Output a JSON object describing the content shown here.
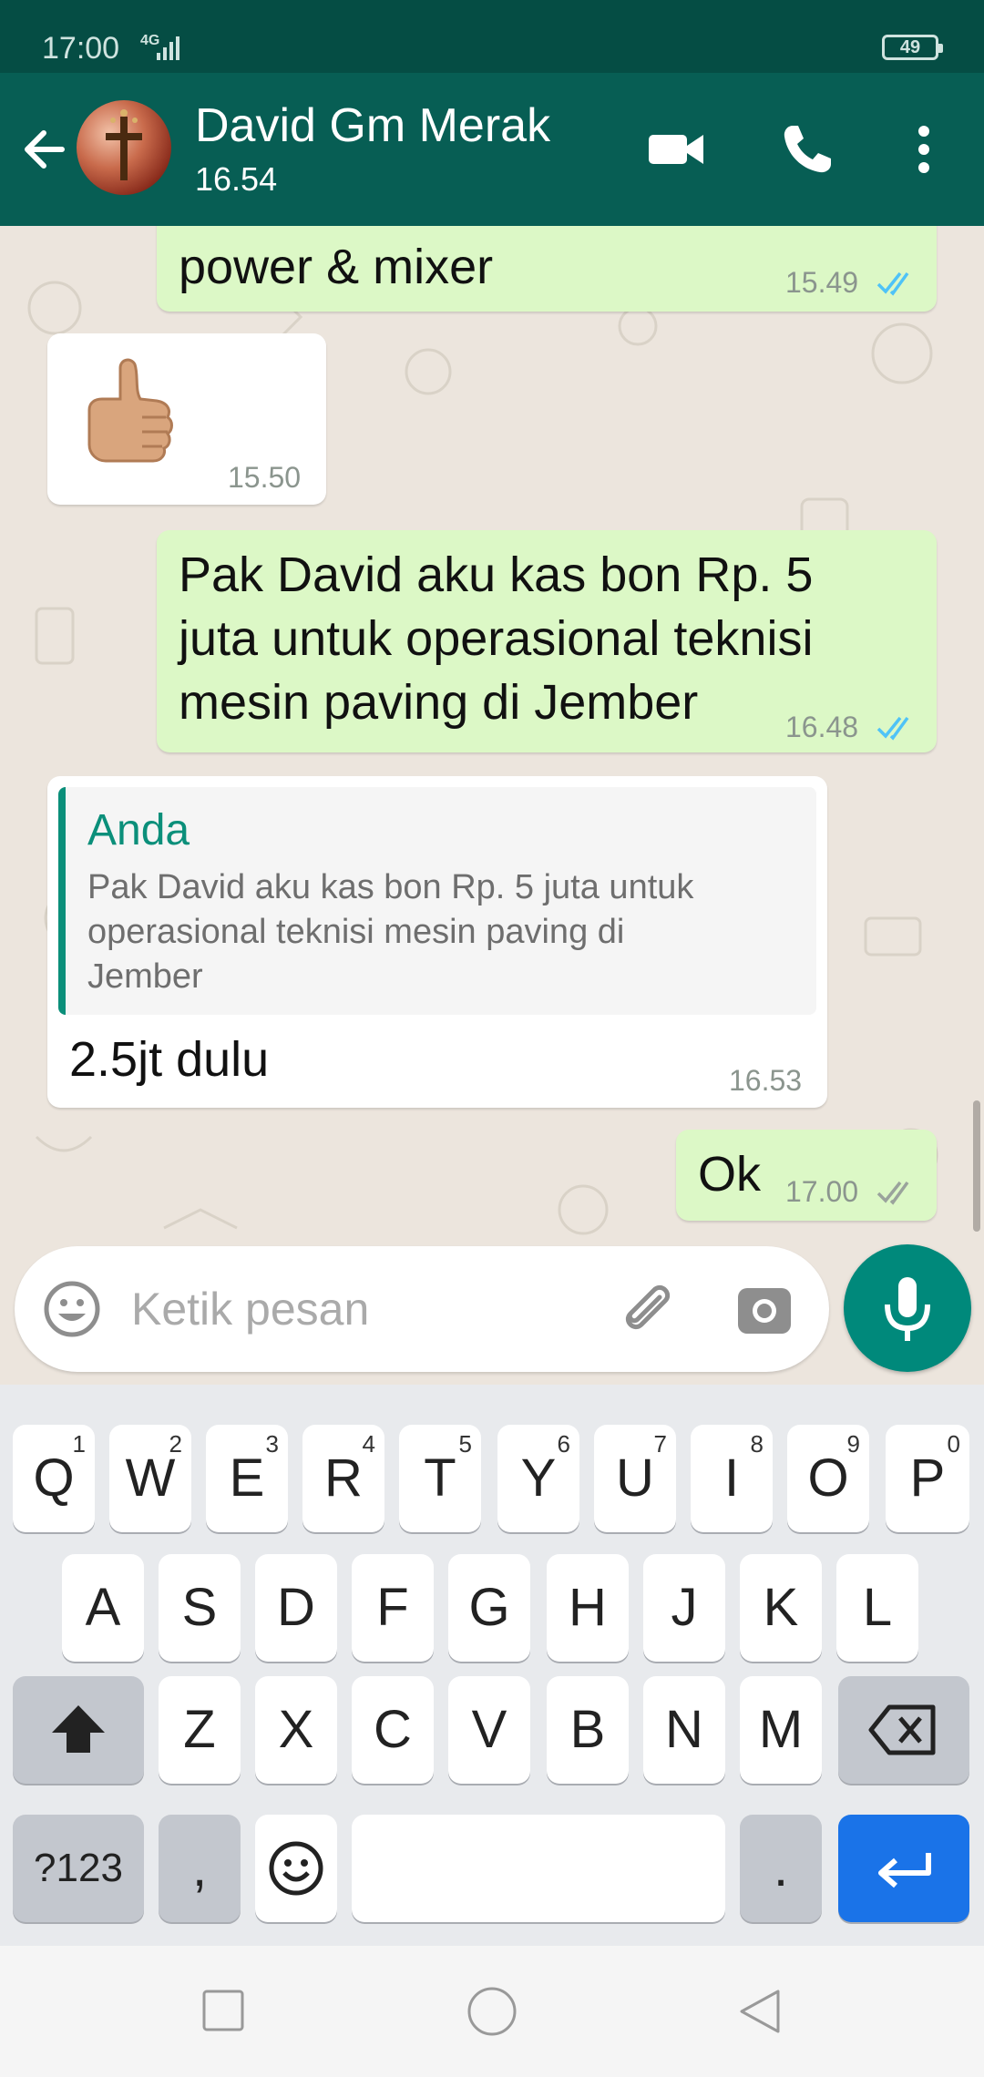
{
  "status_bar": {
    "time": "17:00",
    "network": "4G",
    "battery": "49"
  },
  "header": {
    "contact_name": "David Gm Merak",
    "last_seen": "16.54"
  },
  "messages": [
    {
      "type": "outgoing",
      "text": "power & mixer",
      "time": "15.49",
      "status": "read"
    },
    {
      "type": "incoming",
      "sticker": "thumbs-up",
      "time": "15.50"
    },
    {
      "type": "outgoing",
      "lines": [
        "Pak David aku kas bon Rp. 5",
        "juta untuk operasional teknisi",
        "mesin paving di Jember"
      ],
      "time": "16.48",
      "status": "read"
    },
    {
      "type": "incoming",
      "reply_author": "Anda",
      "reply_lines": [
        "Pak David aku kas bon Rp. 5 juta untuk",
        "operasional teknisi mesin paving di",
        "Jember"
      ],
      "text": "2.5jt dulu",
      "time": "16.53"
    },
    {
      "type": "outgoing",
      "text": "Ok",
      "time": "17.00",
      "status": "delivered"
    }
  ],
  "composer": {
    "placeholder": "Ketik pesan"
  },
  "keyboard": {
    "row1": [
      {
        "k": "Q",
        "h": "1"
      },
      {
        "k": "W",
        "h": "2"
      },
      {
        "k": "E",
        "h": "3"
      },
      {
        "k": "R",
        "h": "4"
      },
      {
        "k": "T",
        "h": "5"
      },
      {
        "k": "Y",
        "h": "6"
      },
      {
        "k": "U",
        "h": "7"
      },
      {
        "k": "I",
        "h": "8"
      },
      {
        "k": "O",
        "h": "9"
      },
      {
        "k": "P",
        "h": "0"
      }
    ],
    "row2": [
      "A",
      "S",
      "D",
      "F",
      "G",
      "H",
      "J",
      "K",
      "L"
    ],
    "row3": [
      "Z",
      "X",
      "C",
      "V",
      "B",
      "N",
      "M"
    ],
    "symbols": "?123",
    "comma": ",",
    "period": "."
  },
  "colors": {
    "header": "#075e54",
    "outgoing_bubble": "#dcf8c6",
    "incoming_bubble": "#ffffff",
    "accent_teal": "#00897b",
    "read_tick": "#4fc3f7",
    "enter_key": "#1a73e8"
  }
}
